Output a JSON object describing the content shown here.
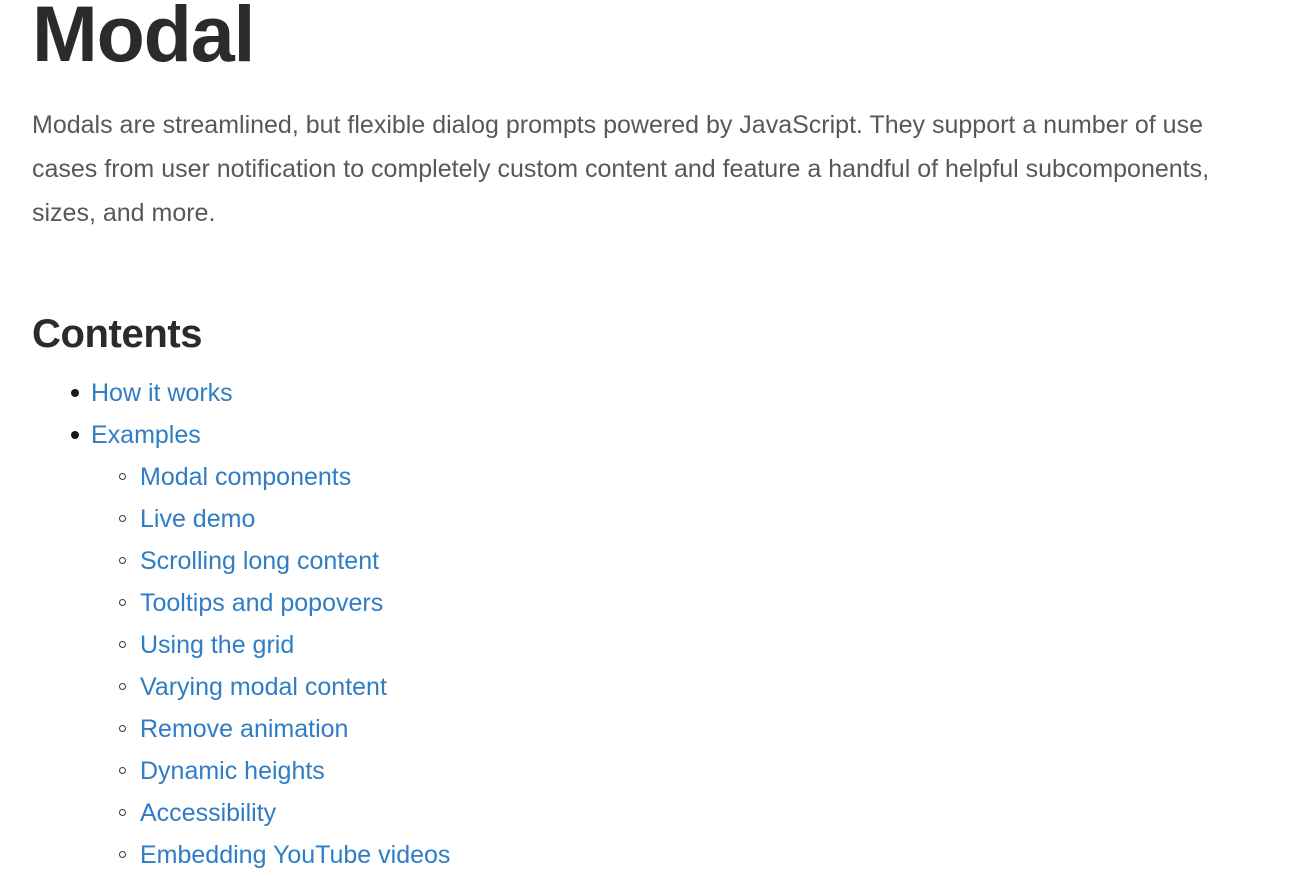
{
  "page": {
    "title": "Modal",
    "lead": "Modals are streamlined, but flexible dialog prompts powered by JavaScript. They support a number of use cases from user notification to completely custom content and feature a handful of helpful subcomponents, sizes, and more."
  },
  "contents": {
    "heading": "Contents",
    "items": [
      {
        "label": "How it works",
        "children": []
      },
      {
        "label": "Examples",
        "children": [
          {
            "label": "Modal components"
          },
          {
            "label": "Live demo"
          },
          {
            "label": "Scrolling long content"
          },
          {
            "label": "Tooltips and popovers"
          },
          {
            "label": "Using the grid"
          },
          {
            "label": "Varying modal content"
          },
          {
            "label": "Remove animation"
          },
          {
            "label": "Dynamic heights"
          },
          {
            "label": "Accessibility"
          },
          {
            "label": "Embedding YouTube videos"
          }
        ]
      }
    ]
  },
  "colors": {
    "background": "#ffffff",
    "heading_text": "#292b2c",
    "body_text": "#55595c",
    "link": "#2f7dc4",
    "bullet_disc": "#1a1a1a",
    "bullet_circle_border": "#3b3b3b"
  }
}
